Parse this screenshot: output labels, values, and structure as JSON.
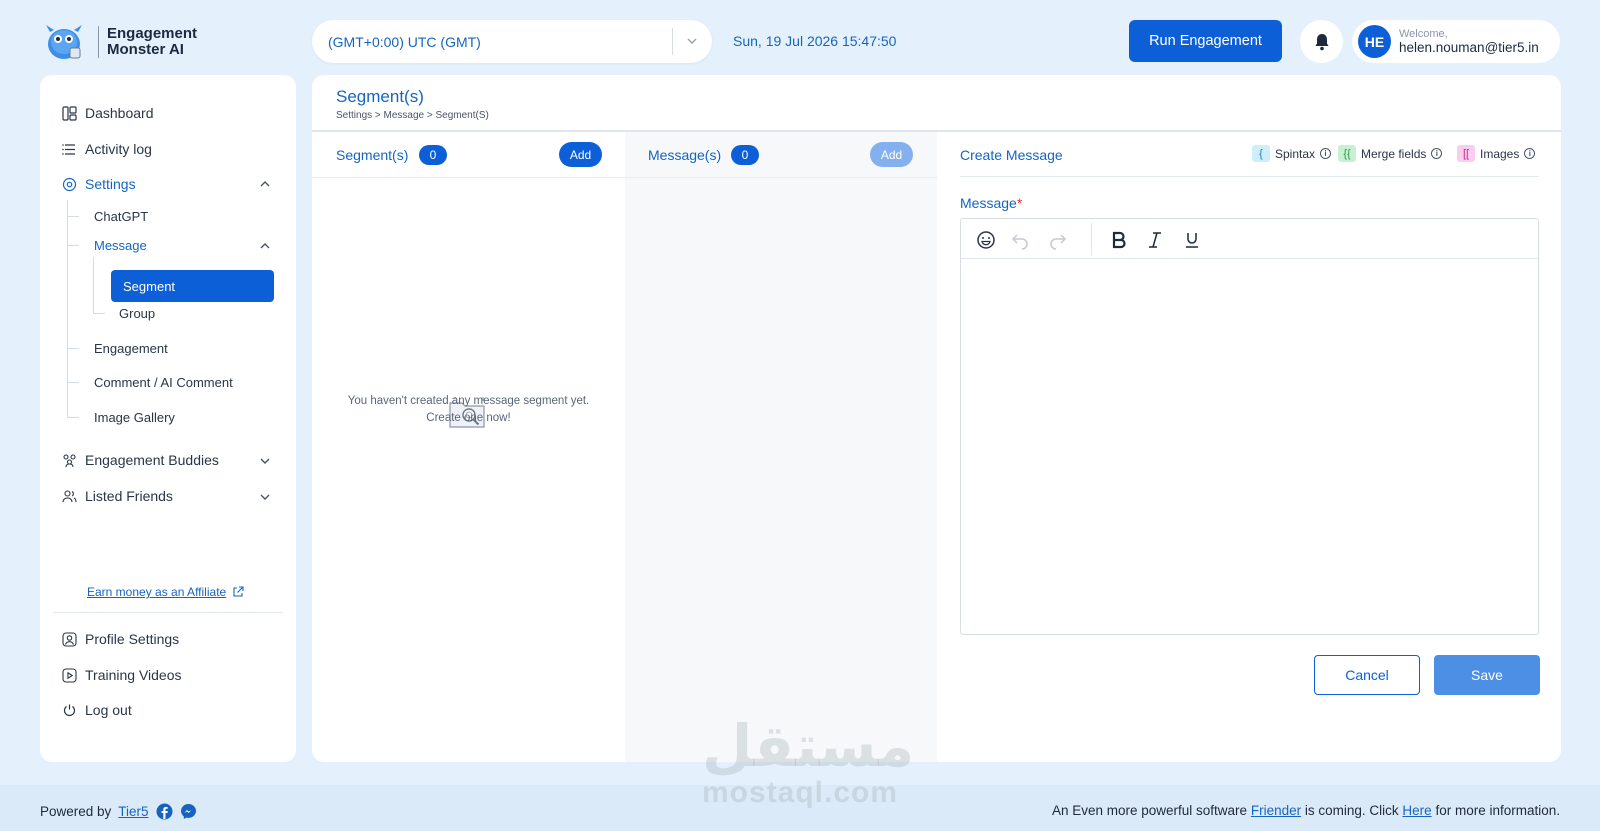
{
  "app": {
    "name_line1": "Engagement",
    "name_line2": "Monster AI"
  },
  "header": {
    "timezone": "(GMT+0:00) UTC (GMT)",
    "datetime": "Sun, 19 Jul 2026 15:47:50",
    "run_label": "Run Engagement",
    "avatar_initials": "HE",
    "welcome": "Welcome,",
    "email": "helen.nouman@tier5.in"
  },
  "sidebar": {
    "dashboard": "Dashboard",
    "activity_log": "Activity log",
    "settings": "Settings",
    "settings_children": {
      "chatgpt": "ChatGPT",
      "message": "Message",
      "segment": "Segment",
      "group": "Group",
      "engagement": "Engagement",
      "comment": "Comment / AI Comment",
      "image_gallery": "Image Gallery"
    },
    "engagement_buddies": "Engagement Buddies",
    "listed_friends": "Listed Friends",
    "affiliate": "Earn money as an Affiliate",
    "profile_settings": "Profile Settings",
    "training_videos": "Training Videos",
    "log_out": "Log out"
  },
  "page": {
    "title": "Segment(s)",
    "breadcrumb": "Settings > Message > Segment(S)"
  },
  "segments_col": {
    "title": "Segment(s)",
    "count": "0",
    "add": "Add",
    "empty_line1": "You haven't created any message segment yet.",
    "empty_line2": "Create one now!"
  },
  "messages_col": {
    "title": "Message(s)",
    "count": "0",
    "add": "Add"
  },
  "create": {
    "title": "Create Message",
    "spintax_symbol": "{",
    "spintax": "Spintax",
    "merge_symbol": "{{",
    "merge": "Merge fields",
    "images_symbol": "[[",
    "images": "Images",
    "message_label": "Message",
    "required_mark": "*",
    "cancel": "Cancel",
    "save": "Save"
  },
  "footer": {
    "powered_by": "Powered by",
    "tier5": "Tier5",
    "note_pre": "An Even more powerful software",
    "friender": "Friender",
    "note_mid": "is coming. Click",
    "here": "Here",
    "note_post": "for more information."
  },
  "watermark": {
    "arabic": "مستقل",
    "latin": "mostaql.com"
  },
  "colors": {
    "primary": "#0d5fd8",
    "accent_text": "#1565c0",
    "page_bg": "#e4f1fc",
    "spintax_chip": "#cfeefb",
    "merge_chip": "#c9f0d2",
    "images_chip": "#f8cdef"
  }
}
